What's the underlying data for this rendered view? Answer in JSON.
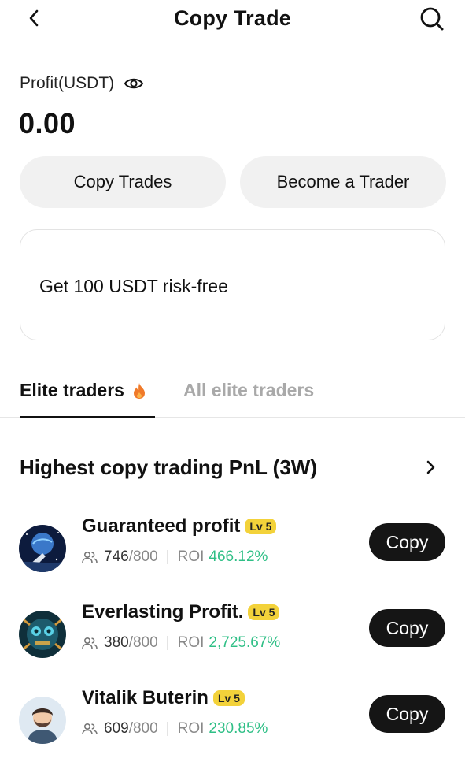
{
  "header": {
    "title": "Copy Trade",
    "back_icon": "chevron-left-icon",
    "search_icon": "search-icon"
  },
  "profit": {
    "label": "Profit(USDT)",
    "value": "0.00",
    "eye_icon": "eye-icon"
  },
  "actions": {
    "copy_trades": "Copy Trades",
    "become_trader": "Become a Trader"
  },
  "promo": {
    "text": "Get 100 USDT risk-free"
  },
  "tabs": [
    {
      "label": "Elite traders",
      "active": true,
      "icon": "fire-icon"
    },
    {
      "label": "All elite traders",
      "active": false
    }
  ],
  "section": {
    "title": "Highest copy trading PnL (3W)",
    "arrow_icon": "chevron-right-icon"
  },
  "traders": [
    {
      "name": "Guaranteed profit",
      "level": "Lv 5",
      "copiers": "746",
      "max": "/800",
      "roi_label": "ROI",
      "roi": "466.12%",
      "action": "Copy",
      "avatar_theme": "space-rocket"
    },
    {
      "name": "Everlasting Profit.",
      "level": "Lv 5",
      "copiers": "380",
      "max": "/800",
      "roi_label": "ROI",
      "roi": "2,725.67%",
      "action": "Copy",
      "avatar_theme": "robot-blue"
    },
    {
      "name": "Vitalik Buterin",
      "level": "Lv 5",
      "copiers": "609",
      "max": "/800",
      "roi_label": "ROI",
      "roi": "230.85%",
      "action": "Copy",
      "avatar_theme": "bearded-man"
    }
  ],
  "colors": {
    "accent_green": "#2fbf86",
    "badge_yellow": "#f3d23a",
    "button_dark": "#151515",
    "pill_bg": "#f1f1f1",
    "fire": "#f07a2a"
  }
}
